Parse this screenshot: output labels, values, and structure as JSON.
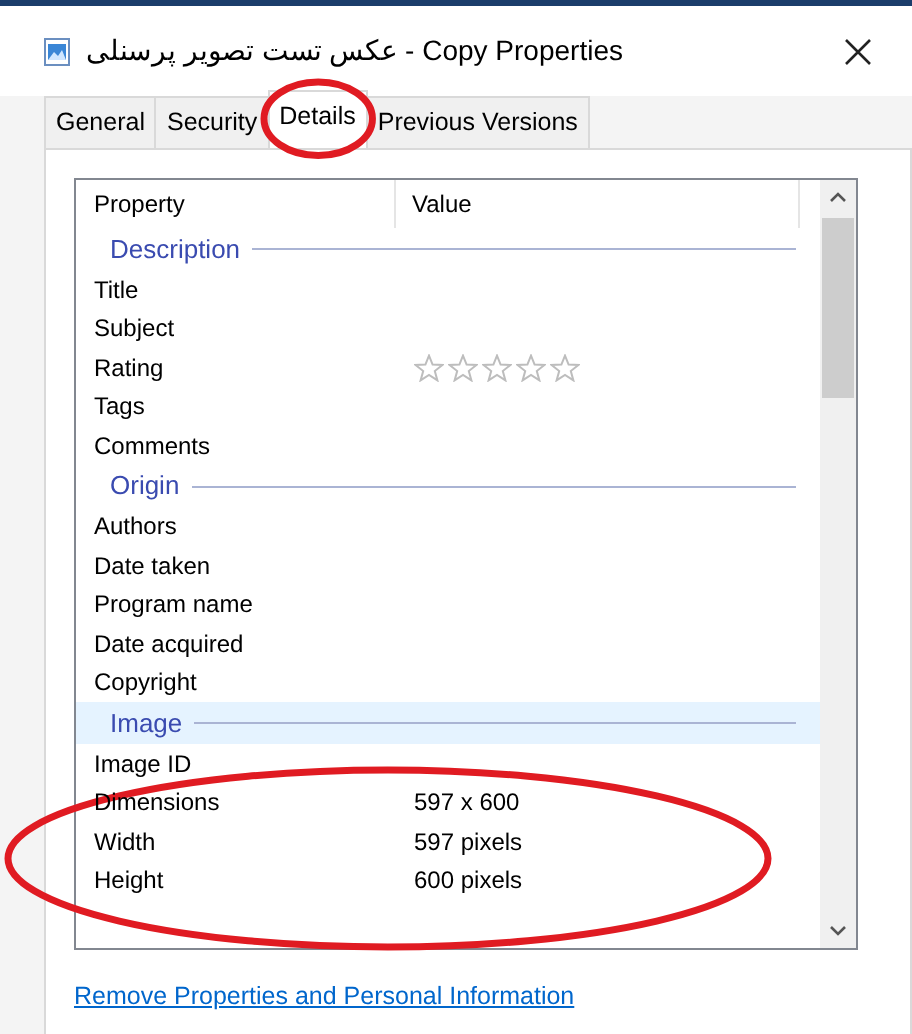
{
  "window": {
    "title": "عکس تست تصویر پرسنلی - Copy Properties"
  },
  "tabs": [
    {
      "label": "General",
      "selected": false,
      "circled": false
    },
    {
      "label": "Security",
      "selected": false,
      "circled": false
    },
    {
      "label": "Details",
      "selected": true,
      "circled": true
    },
    {
      "label": "Previous Versions",
      "selected": false,
      "circled": false
    }
  ],
  "columns": [
    "Property",
    "Value"
  ],
  "groups": [
    {
      "name": "Description",
      "selected": false,
      "rows": [
        {
          "kind": "text",
          "property": "Title",
          "circled": false
        },
        {
          "kind": "text",
          "property": "Subject",
          "circled": false
        },
        {
          "kind": "stars",
          "property": "Rating",
          "stars": 0,
          "circled": false
        },
        {
          "kind": "text",
          "property": "Tags",
          "circled": false
        },
        {
          "kind": "text",
          "property": "Comments",
          "circled": false
        }
      ]
    },
    {
      "name": "Origin",
      "selected": false,
      "rows": [
        {
          "kind": "text",
          "property": "Authors",
          "circled": false
        },
        {
          "kind": "text",
          "property": "Date taken",
          "circled": false
        },
        {
          "kind": "text",
          "property": "Program name",
          "circled": false
        },
        {
          "kind": "text",
          "property": "Date acquired",
          "circled": false
        },
        {
          "kind": "text",
          "property": "Copyright",
          "circled": false
        }
      ]
    },
    {
      "name": "Image",
      "selected": true,
      "rows": [
        {
          "kind": "text",
          "property": "Image ID",
          "circled": false
        },
        {
          "kind": "text",
          "property": "Dimensions",
          "value": "597 x 600",
          "circled": true
        },
        {
          "kind": "text",
          "property": "Width",
          "value": "597 pixels",
          "circled": true
        },
        {
          "kind": "text",
          "property": "Height",
          "value": "600 pixels",
          "circled": true
        }
      ]
    }
  ],
  "link": "Remove Properties and Personal Information"
}
